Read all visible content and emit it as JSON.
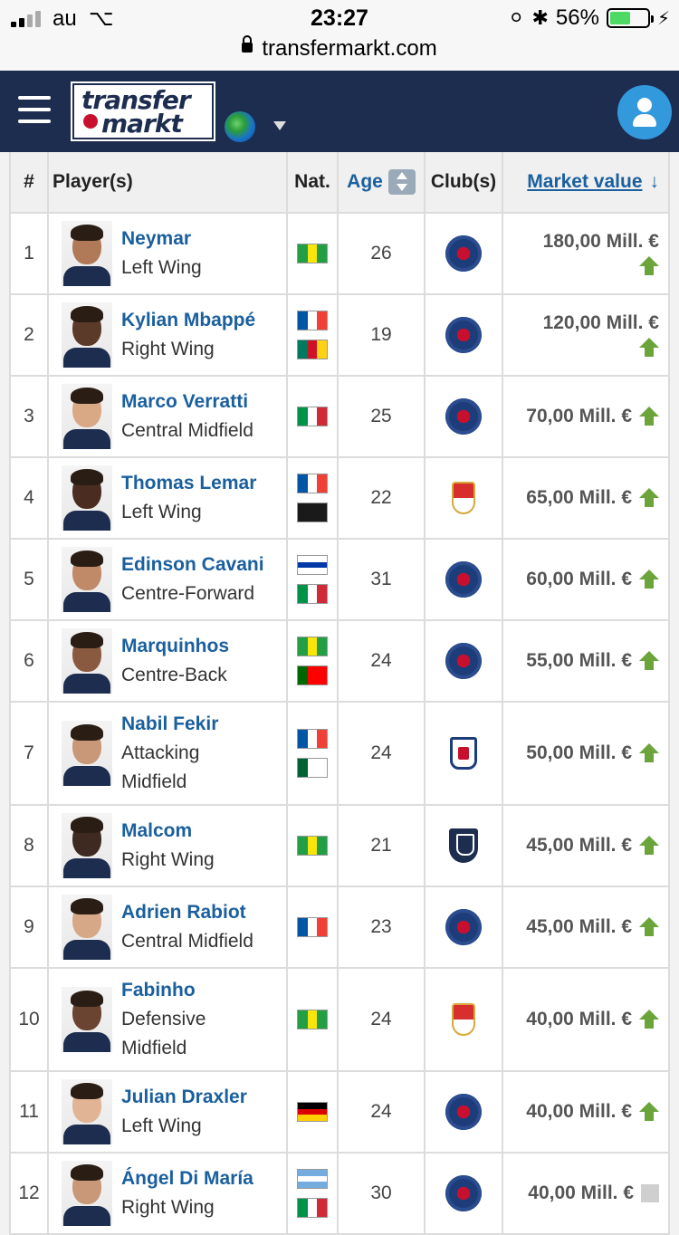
{
  "status": {
    "carrier": "au",
    "time": "23:27",
    "battery": "56%",
    "battery_level": 0.56
  },
  "browser": {
    "url": "transfermarkt.com"
  },
  "header": {
    "logo_line1": "transfer",
    "logo_line2": "markt"
  },
  "table": {
    "columns": {
      "num": "#",
      "player": "Player(s)",
      "nat": "Nat.",
      "age": "Age",
      "club": "Club(s)",
      "mv": "Market value"
    },
    "rows": [
      {
        "num": "1",
        "name": "Neymar",
        "position": "Left Wing",
        "nat": [
          "brazil"
        ],
        "age": "26",
        "club": "psg",
        "value": "180,00 Mill. €",
        "trend": "up"
      },
      {
        "num": "2",
        "name": "Kylian Mbappé",
        "position": "Right Wing",
        "nat": [
          "france",
          "cameroon"
        ],
        "age": "19",
        "club": "psg",
        "value": "120,00 Mill. €",
        "trend": "up"
      },
      {
        "num": "3",
        "name": "Marco Verratti",
        "position": "Central Midfield",
        "nat": [
          "italy"
        ],
        "age": "25",
        "club": "psg",
        "value": "70,00 Mill. €",
        "trend": "up"
      },
      {
        "num": "4",
        "name": "Thomas Lemar",
        "position": "Left Wing",
        "nat": [
          "france",
          "guadeloupe"
        ],
        "age": "22",
        "club": "monaco",
        "value": "65,00 Mill. €",
        "trend": "up"
      },
      {
        "num": "5",
        "name": "Edinson Cavani",
        "position": "Centre-Forward",
        "nat": [
          "uruguay",
          "italy"
        ],
        "age": "31",
        "club": "psg",
        "value": "60,00 Mill. €",
        "trend": "up"
      },
      {
        "num": "6",
        "name": "Marquinhos",
        "position": "Centre-Back",
        "nat": [
          "brazil",
          "portugal"
        ],
        "age": "24",
        "club": "psg",
        "value": "55,00 Mill. €",
        "trend": "up"
      },
      {
        "num": "7",
        "name": "Nabil Fekir",
        "position": "Attacking Midfield",
        "nat": [
          "france",
          "algeria"
        ],
        "age": "24",
        "club": "lyon",
        "value": "50,00 Mill. €",
        "trend": "up"
      },
      {
        "num": "8",
        "name": "Malcom",
        "position": "Right Wing",
        "nat": [
          "brazil"
        ],
        "age": "21",
        "club": "bordeaux",
        "value": "45,00 Mill. €",
        "trend": "up"
      },
      {
        "num": "9",
        "name": "Adrien Rabiot",
        "position": "Central Midfield",
        "nat": [
          "france"
        ],
        "age": "23",
        "club": "psg",
        "value": "45,00 Mill. €",
        "trend": "up"
      },
      {
        "num": "10",
        "name": "Fabinho",
        "position": "Defensive Midfield",
        "nat": [
          "brazil"
        ],
        "age": "24",
        "club": "monaco",
        "value": "40,00 Mill. €",
        "trend": "up"
      },
      {
        "num": "11",
        "name": "Julian Draxler",
        "position": "Left Wing",
        "nat": [
          "germany"
        ],
        "age": "24",
        "club": "psg",
        "value": "40,00 Mill. €",
        "trend": "up"
      },
      {
        "num": "12",
        "name": "Ángel Di María",
        "position": "Right Wing",
        "nat": [
          "argentina",
          "italy"
        ],
        "age": "30",
        "club": "psg",
        "value": "40,00 Mill. €",
        "trend": "same"
      }
    ]
  },
  "colors": {
    "header_bg": "#1d2d50",
    "link": "#1a5f9e",
    "up_arrow": "#6aa43a",
    "user_btn": "#3399dd"
  }
}
